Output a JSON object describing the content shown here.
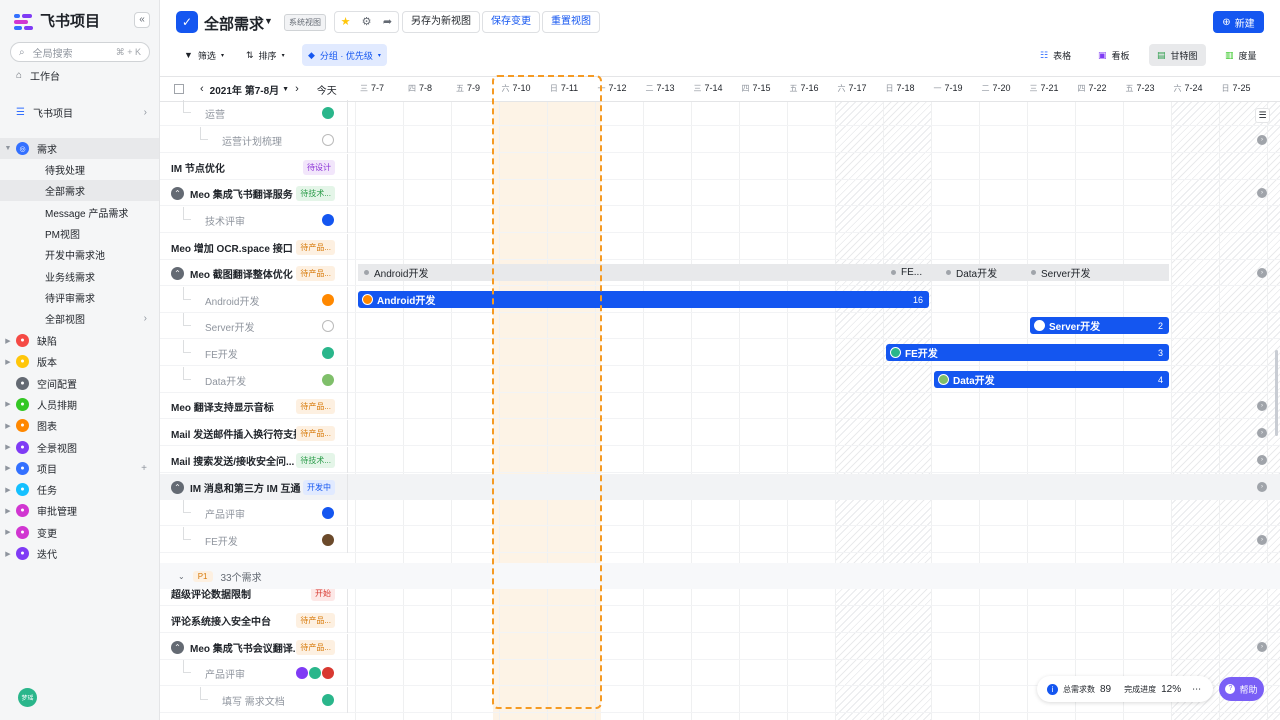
{
  "app": {
    "name": "飞书项目"
  },
  "sidebar": {
    "search_placeholder": "全局搜索",
    "search_shortcut": "⌘ + K",
    "workbench": "工作台",
    "project": "飞书项目",
    "demand": "需求",
    "demand_children": [
      "待我处理",
      "全部需求",
      "Message 产品需求",
      "PM视图",
      "开发中需求池",
      "业务线需求",
      "待评审需求",
      "全部视图"
    ],
    "modules": [
      {
        "label": "缺陷",
        "color": "#f54a45"
      },
      {
        "label": "版本",
        "color": "#ffc60a"
      },
      {
        "label": "空间配置",
        "color": "#646a73"
      },
      {
        "label": "人员排期",
        "color": "#34c724"
      },
      {
        "label": "图表",
        "color": "#ff8800"
      },
      {
        "label": "全景视图",
        "color": "#7f3bf5"
      },
      {
        "label": "项目",
        "color": "#3370ff"
      },
      {
        "label": "任务",
        "color": "#14c0ff"
      },
      {
        "label": "审批管理",
        "color": "#d136d1"
      },
      {
        "label": "变更",
        "color": "#d136d1"
      },
      {
        "label": "迭代",
        "color": "#7f3bf5"
      }
    ],
    "user_avatar": "梦瑶"
  },
  "header": {
    "title": "全部需求",
    "badge": "系统视图",
    "save_as": "另存为新视图",
    "save_changes": "保存变更",
    "reset_view": "重置视图",
    "new": "新建"
  },
  "toolbar": {
    "filter": "筛选",
    "sort": "排序",
    "group": "分组 · 优先级",
    "views": [
      "表格",
      "看板",
      "甘特图",
      "度量"
    ]
  },
  "gantt": {
    "month": "2021年 第7-8月",
    "today": "今天",
    "days": [
      {
        "w": "三",
        "d": "7-7"
      },
      {
        "w": "四",
        "d": "7-8"
      },
      {
        "w": "五",
        "d": "7-9"
      },
      {
        "w": "六",
        "d": "7-10"
      },
      {
        "w": "日",
        "d": "7-11"
      },
      {
        "w": "一",
        "d": "7-12"
      },
      {
        "w": "二",
        "d": "7-13"
      },
      {
        "w": "三",
        "d": "7-14"
      },
      {
        "w": "四",
        "d": "7-15"
      },
      {
        "w": "五",
        "d": "7-16"
      },
      {
        "w": "六",
        "d": "7-17"
      },
      {
        "w": "日",
        "d": "7-18"
      },
      {
        "w": "一",
        "d": "7-19"
      },
      {
        "w": "二",
        "d": "7-20"
      },
      {
        "w": "三",
        "d": "7-21"
      },
      {
        "w": "四",
        "d": "7-22"
      },
      {
        "w": "五",
        "d": "7-23"
      },
      {
        "w": "六",
        "d": "7-24"
      },
      {
        "w": "日",
        "d": "7-25"
      }
    ]
  },
  "rows": [
    {
      "label": "运营",
      "child": true
    },
    {
      "label": "运营计划梳理",
      "child": true
    },
    {
      "label": "IM 节点优化",
      "tag": "待设计"
    },
    {
      "label": "Meo 集成飞书翻译服务",
      "tag": "待技术..."
    },
    {
      "label": "技术评审",
      "child": true
    },
    {
      "label": "Meo 增加 OCR.space 接口",
      "tag": "待产品..."
    },
    {
      "label": "Meo 截图翻译整体优化",
      "tag": "待产品..."
    },
    {
      "label": "Android开发",
      "child": true
    },
    {
      "label": "Server开发",
      "child": true
    },
    {
      "label": "FE开发",
      "child": true
    },
    {
      "label": "Data开发",
      "child": true
    },
    {
      "label": "Meo 翻译支持显示音标",
      "tag": "待产品..."
    },
    {
      "label": "Mail 发送邮件插入换行符支持",
      "tag": "待产品..."
    },
    {
      "label": "Mail 搜索发送/接收安全问...",
      "tag": "待技术..."
    },
    {
      "label": "IM 消息和第三方 IM 互通",
      "tag": "开发中"
    },
    {
      "label": "产品评审",
      "child": true
    },
    {
      "label": "FE开发",
      "child": true
    },
    {
      "label": "超级评论数据限制",
      "tag": "开始"
    },
    {
      "label": "评论系统接入安全中台",
      "tag": "待产品..."
    },
    {
      "label": "Meo 集成飞书会议翻译...",
      "tag": "待产品..."
    },
    {
      "label": "产品评审",
      "child": true
    },
    {
      "label": "填写 需求文档",
      "child": true
    }
  ],
  "group_bar": [
    "Android开发",
    "FE...",
    "Data开发",
    "Server开发"
  ],
  "bars": [
    {
      "label": "Android开发",
      "count": "16"
    },
    {
      "label": "Server开发",
      "count": "2"
    },
    {
      "label": "FE开发",
      "count": "3"
    },
    {
      "label": "Data开发",
      "count": "4"
    }
  ],
  "priority_group": {
    "tag": "P1",
    "count": "33个需求"
  },
  "stats": {
    "total_label": "总需求数",
    "total": "89",
    "progress_label": "完成进度",
    "progress": "12%"
  },
  "help": "帮助"
}
